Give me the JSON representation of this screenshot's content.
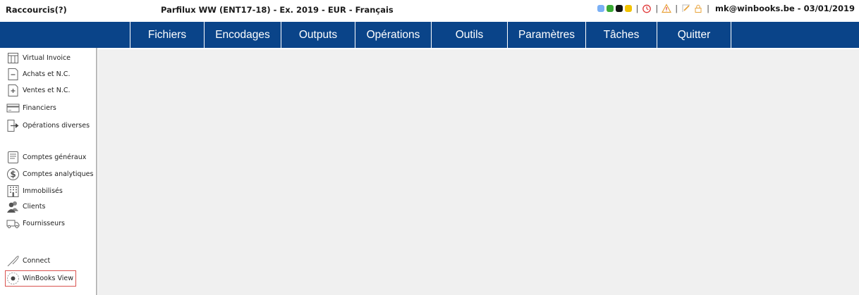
{
  "header": {
    "shortcuts_label": "Raccourcis(?)",
    "app_title": "Parfilux WW (ENT17-18) - Ex. 2019 - EUR - Français",
    "user_info": "mk@winbooks.be - 03/01/2019",
    "separator": "|",
    "status_colors": [
      "#7ab0f5",
      "#3aaa35",
      "#111111",
      "#f2c200"
    ]
  },
  "menu": {
    "items": [
      {
        "label": "Fichiers"
      },
      {
        "label": "Encodages"
      },
      {
        "label": "Outputs"
      },
      {
        "label": "Opérations"
      },
      {
        "label": "Outils"
      },
      {
        "label": "Paramètres"
      },
      {
        "label": "Tâches"
      },
      {
        "label": "Quitter"
      }
    ],
    "background": "#0a4489"
  },
  "sidebar": {
    "group1": [
      {
        "label": "Virtual Invoice",
        "icon": "virtual-invoice-icon"
      },
      {
        "label": "Achats et N.C.",
        "icon": "purchase-document-icon"
      },
      {
        "label": "Ventes et N.C.",
        "icon": "sales-document-icon"
      },
      {
        "label": "Financiers",
        "icon": "card-icon"
      },
      {
        "label": "Opérations diverses",
        "icon": "misc-operations-icon"
      }
    ],
    "group2": [
      {
        "label": "Comptes généraux",
        "icon": "ledger-icon"
      },
      {
        "label": "Comptes analytiques",
        "icon": "dollar-icon"
      },
      {
        "label": "Immobilisés",
        "icon": "building-icon"
      },
      {
        "label": "Clients",
        "icon": "clients-icon"
      },
      {
        "label": "Fournisseurs",
        "icon": "truck-icon"
      }
    ],
    "group3": [
      {
        "label": "Connect",
        "icon": "connect-icon"
      },
      {
        "label": "WinBooks View",
        "icon": "view-icon"
      }
    ],
    "highlight_color": "#d9534f"
  }
}
